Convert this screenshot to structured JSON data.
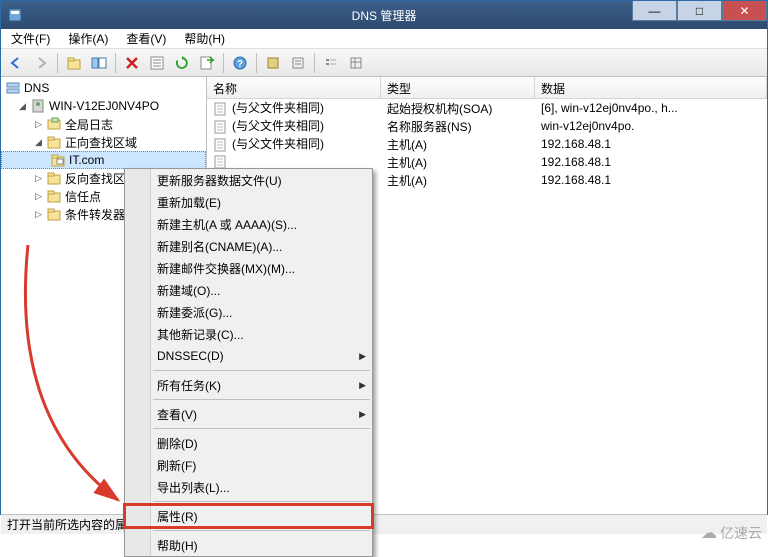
{
  "titlebar": {
    "title": "DNS 管理器"
  },
  "win_buttons": {
    "min": "—",
    "max": "□",
    "close": "✕"
  },
  "menubar": {
    "file": "文件(F)",
    "action": "操作(A)",
    "view": "查看(V)",
    "help": "帮助(H)"
  },
  "tree": {
    "root": "DNS",
    "server": "WIN-V12EJ0NV4PO",
    "global_log": "全局日志",
    "fwd_zones": "正向查找区域",
    "zone_sel": "IT.com",
    "rev_zones": "反向查找区域",
    "trust": "信任点",
    "cond": "条件转发器"
  },
  "list": {
    "headers": {
      "name": "名称",
      "type": "类型",
      "data": "数据"
    },
    "rows": [
      {
        "name": "(与父文件夹相同)",
        "type": "起始授权机构(SOA)",
        "data": "[6], win-v12ej0nv4po., h..."
      },
      {
        "name": "(与父文件夹相同)",
        "type": "名称服务器(NS)",
        "data": "win-v12ej0nv4po."
      },
      {
        "name": "(与父文件夹相同)",
        "type": "主机(A)",
        "data": "192.168.48.1"
      },
      {
        "name": "",
        "type": "主机(A)",
        "data": "192.168.48.1"
      },
      {
        "name": "",
        "type": "主机(A)",
        "data": "192.168.48.1"
      }
    ]
  },
  "context_menu": {
    "update": "更新服务器数据文件(U)",
    "reload": "重新加载(E)",
    "new_host": "新建主机(A 或 AAAA)(S)...",
    "new_cname": "新建别名(CNAME)(A)...",
    "new_mx": "新建邮件交换器(MX)(M)...",
    "new_domain": "新建域(O)...",
    "new_delegate": "新建委派(G)...",
    "other_record": "其他新记录(C)...",
    "dnssec": "DNSSEC(D)",
    "all_tasks": "所有任务(K)",
    "view": "查看(V)",
    "delete": "删除(D)",
    "refresh": "刷新(F)",
    "export": "导出列表(L)...",
    "properties": "属性(R)",
    "help": "帮助(H)"
  },
  "statusbar": {
    "text": "打开当前所选内容的属性对话框。"
  },
  "watermark": {
    "text": "亿速云"
  }
}
